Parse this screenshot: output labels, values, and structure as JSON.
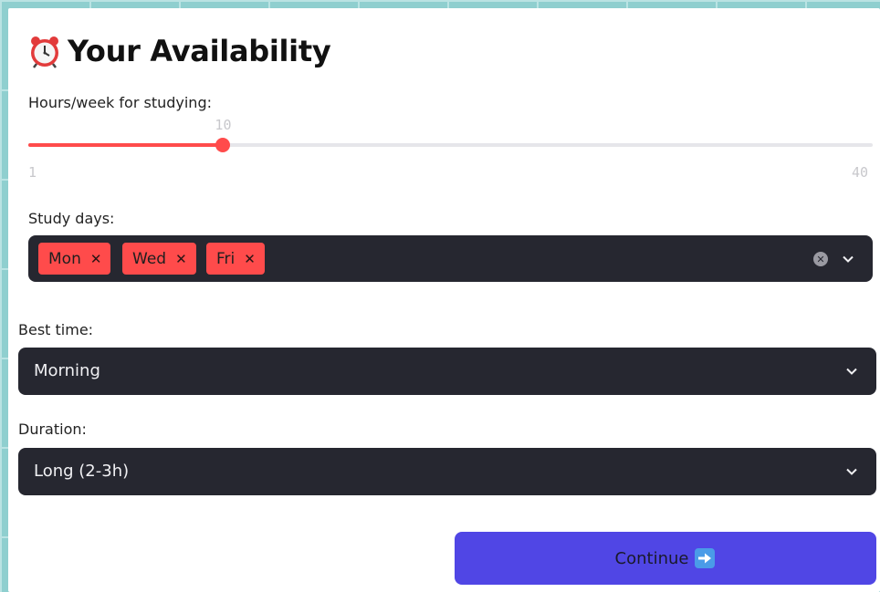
{
  "header": {
    "title": "Your Availability",
    "icon": "alarm-clock-icon"
  },
  "hours": {
    "label": "Hours/week for studying:",
    "value": 10,
    "min": 1,
    "max": 40,
    "value_text": "10",
    "min_text": "1",
    "max_text": "40"
  },
  "study_days": {
    "label": "Study days:",
    "selected": [
      "Mon",
      "Wed",
      "Fri"
    ]
  },
  "best_time": {
    "label": "Best time:",
    "value": "Morning"
  },
  "duration": {
    "label": "Duration:",
    "value": "Long (2-3h)"
  },
  "continue_button": {
    "label": "Continue",
    "icon": "right-arrow-icon"
  },
  "colors": {
    "accent": "#ff4b4b",
    "primary_button": "#5046e5",
    "input_bg": "#262730",
    "background": "#8fcfcf"
  }
}
